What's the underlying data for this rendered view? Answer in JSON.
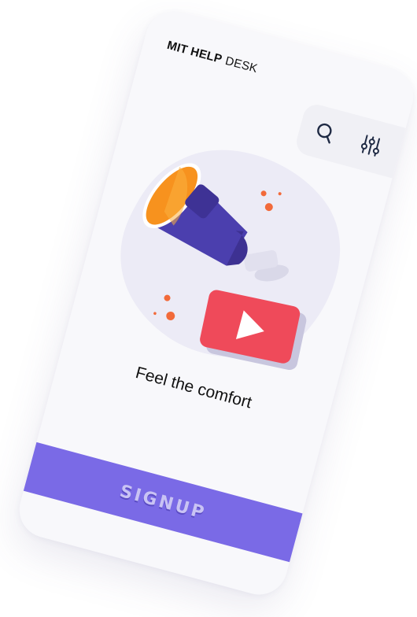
{
  "header": {
    "brand_bold": "MIT HELP",
    "brand_light": "DESK",
    "search_icon": "search-icon",
    "filter_icon": "sliders-icon"
  },
  "hero": {
    "illustration": "megaphone-with-play-button",
    "tagline": "Feel the comfort"
  },
  "cta": {
    "signup_label": "SIGNUP"
  },
  "colors": {
    "primary": "#7a6ae6",
    "megaphone": "#4b3fae",
    "megaphone_inner": "#f7921e",
    "play_button": "#ef4a5a",
    "accent_dots": "#f26a3a",
    "blob": "#ecebf6"
  }
}
